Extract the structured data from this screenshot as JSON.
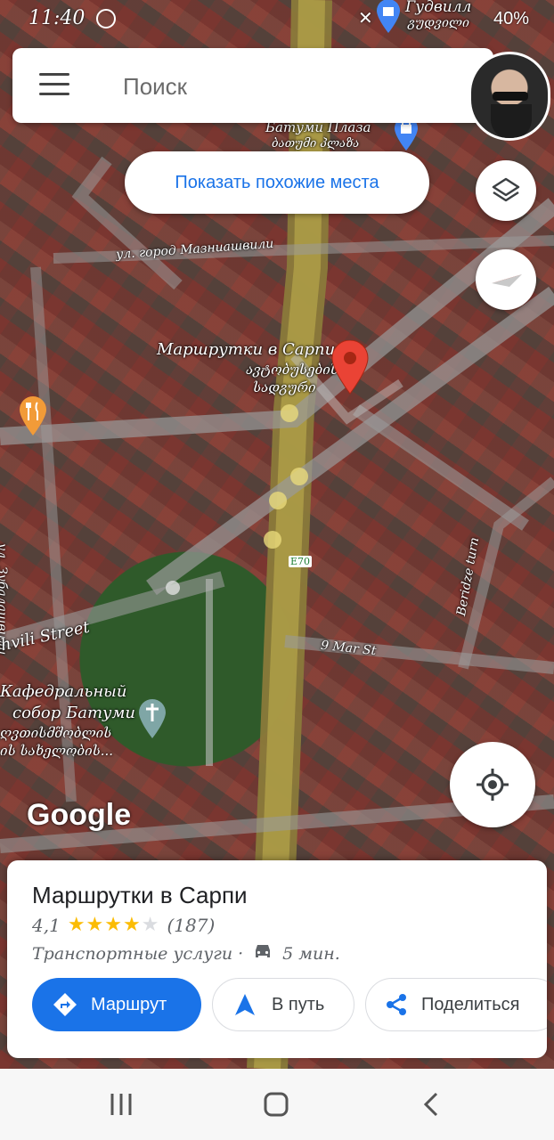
{
  "status_bar": {
    "time": "11:40",
    "battery": "40%"
  },
  "search": {
    "placeholder": "Поиск"
  },
  "chip": {
    "label": "Показать похожие места"
  },
  "map_labels": {
    "top_place": "Гудвилл",
    "top_place_geo": "გუდვილი",
    "batumi_plaza": "Батуми Плаза",
    "batumi_plaza_geo": "ბათუმი პლაზა",
    "street_maznia": "ул. город Мазниашвили",
    "marker_title": "Маршрутки в Сарпи",
    "marker_geo_1": "ავტობუსების",
    "marker_geo_2": "სადგური",
    "street_zubalashvili": "ул. Зубалашвили",
    "street_berid": "Beridze turn",
    "road_e70": "E70",
    "street_9mar": "9 Mar St",
    "street_hvili": "hvili Street",
    "cathedral_1": "Кафедральный",
    "cathedral_2": "собор Батуми",
    "cathedral_geo_1": "ღვთისმშობლის",
    "cathedral_geo_2": "ის სახელობის..."
  },
  "google_logo": "Google",
  "card": {
    "title": "Маршрутки в Сарпи",
    "rating": "4,1",
    "stars_filled": 4,
    "reviews": "(187)",
    "category": "Транспортные услуги",
    "separator": "·",
    "drive_time": "5 мин.",
    "buttons": {
      "route": "Маршрут",
      "go": "В путь",
      "share": "Поделиться"
    }
  },
  "colors": {
    "accent": "#1a73e8",
    "marker": "#ea4335",
    "star": "#fbbc04"
  },
  "icons": [
    "menu-icon",
    "layers-icon",
    "compass-icon",
    "my-location-icon",
    "directions-icon",
    "navigation-icon",
    "share-icon",
    "car-icon",
    "pin-icon",
    "restaurant-icon",
    "shopping-icon",
    "church-icon"
  ]
}
